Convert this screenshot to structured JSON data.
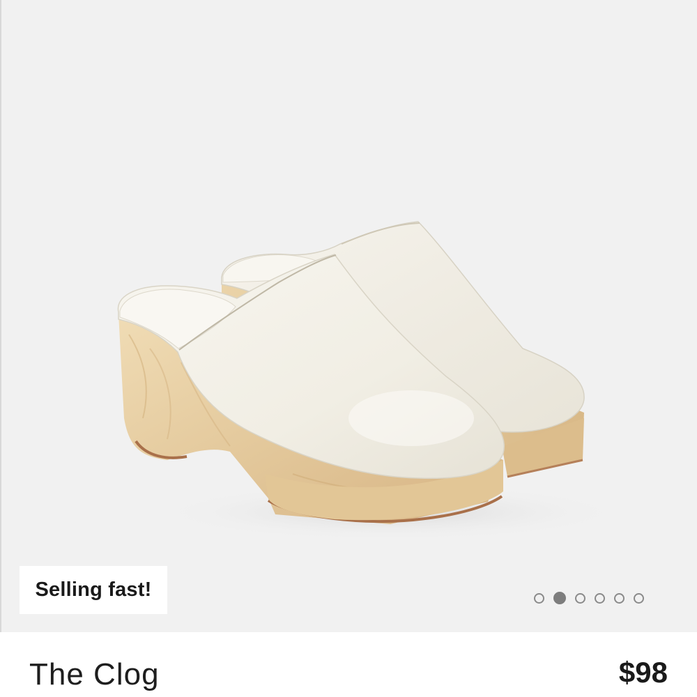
{
  "product": {
    "title": "The Clog",
    "price": "$98",
    "badge": "Selling fast!",
    "image_icon": "clog-image"
  },
  "carousel": {
    "total_slides": 6,
    "active_slide": 2
  },
  "colors": {
    "hero_background": "#f1f1f1",
    "leather": "#f4f1e8",
    "wood": "#e0c493",
    "wood_dark": "#b07a50",
    "dot_active": "#7d7d7d"
  }
}
